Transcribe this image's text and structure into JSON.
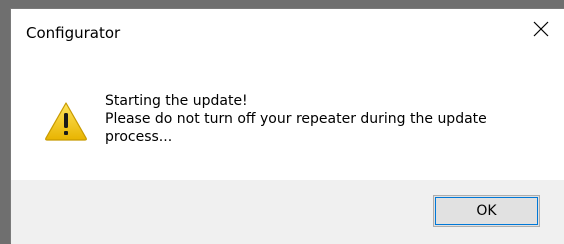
{
  "window": {
    "title": "Configurator",
    "close_icon": "close-icon"
  },
  "message": {
    "icon": "warning-icon",
    "line1": "Starting the update!",
    "line2": "Please do not turn off your repeater during the update",
    "line3": "process..."
  },
  "buttons": {
    "ok_label": "OK"
  },
  "colors": {
    "warning_fill": "#f2c80f",
    "accent_focus": "#0078d7",
    "footer_bg": "#f0f0f0"
  }
}
